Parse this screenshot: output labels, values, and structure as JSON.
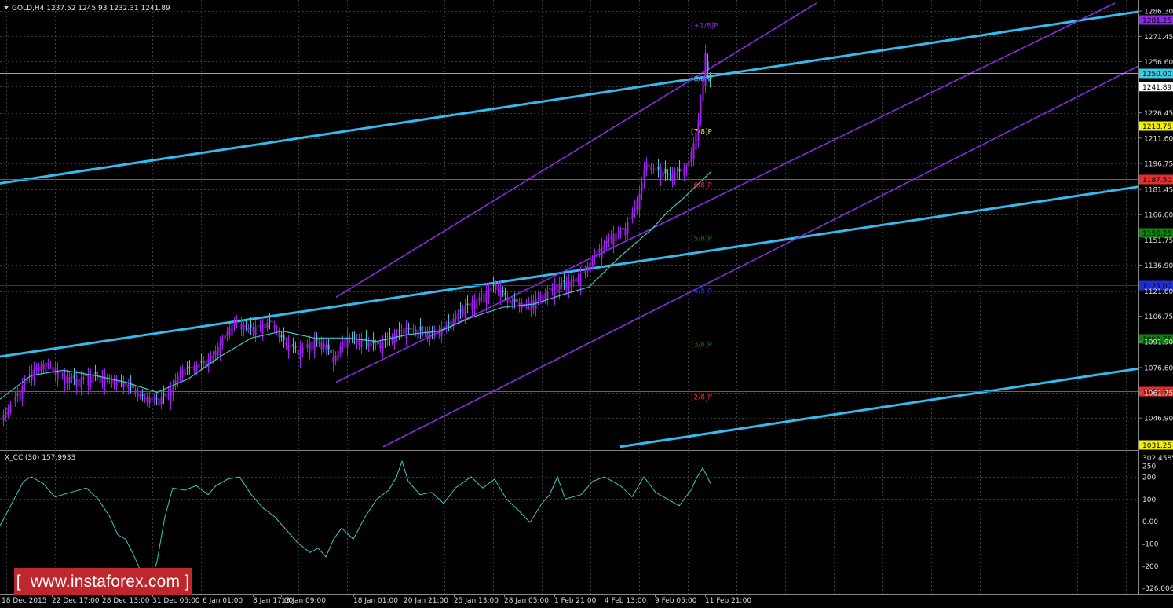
{
  "window": {
    "header": "GOLD,H4  1237.52 1245.93 1232.31 1241.89",
    "indicator_header": "X_CCI(30) 157.9933"
  },
  "colors": {
    "background": "#000000",
    "grid": "#3c3c3c",
    "candle": "#a020f0",
    "ma": "#40c8c8",
    "trend_cyan": "#33bbee",
    "channel": "#8a2be2",
    "cci": "#40c8c8",
    "watermark": "#c0272d"
  },
  "price_axis": {
    "ticks": [
      "1286.30",
      "1271.45",
      "1256.60",
      "1241.89",
      "1226.45",
      "1211.60",
      "1196.75",
      "1181.45",
      "1166.60",
      "1151.75",
      "1136.90",
      "1121.60",
      "1106.75",
      "1091.90",
      "1076.60",
      "1061.75",
      "1046.90"
    ],
    "range": [
      1028.5,
      1291
    ]
  },
  "levels": [
    {
      "value": "1281.25",
      "label": "[+1/8]P",
      "line_color": "#8a2be2",
      "box_color": "#8a2be2",
      "text_color": "#000000",
      "label_color": "#8a2be2"
    },
    {
      "value": "1250.00",
      "label": "[8/8]P",
      "line_color": "#40c8e0",
      "box_color": "#40c8e0",
      "text_color": "#000000",
      "label_color": "#40c8e0"
    },
    {
      "value": "1218.75",
      "label": "[7/8]P",
      "line_color": "#e8e8a0",
      "box_color": "#f0f000",
      "text_color": "#000000",
      "label_color": "#f0f000"
    },
    {
      "value": "1187.50",
      "label": "[6/8]P",
      "line_color": "#e03030",
      "box_color": "#e03030",
      "text_color": "#000000",
      "label_color": "#e03030"
    },
    {
      "value": "1156.25",
      "label": "[5/8]P",
      "line_color": "#108010",
      "box_color": "#108010",
      "text_color": "#000000",
      "label_color": "#108010"
    },
    {
      "value": "1125.00",
      "label": "[4/8]P",
      "line_color": "#2030d0",
      "box_color": "#2030d0",
      "text_color": "#000000",
      "label_color": "#2030d0"
    },
    {
      "value": "1093.75",
      "label": "[3/8]P",
      "line_color": "#108010",
      "box_color": "#108010",
      "text_color": "#000000",
      "label_color": "#108010"
    },
    {
      "value": "1062.50",
      "label": "[2/8]P",
      "line_color": "#e03030",
      "box_color": "#e03030",
      "text_color": "#000000",
      "label_color": "#e03030"
    },
    {
      "value": "1031.25",
      "label": "",
      "line_color": "#f0f000",
      "box_color": "#f0f000",
      "text_color": "#000000",
      "label_color": "#f0f000"
    }
  ],
  "current_price": "1241.89",
  "cci_axis": {
    "ticks": [
      "302.4585",
      "250",
      "200",
      "100",
      "0.00",
      "-100",
      "-200",
      "-326.0061"
    ]
  },
  "time_axis": {
    "labels": [
      "18 Dec 2015",
      "22 Dec 17:00",
      "28 Dec 13:00",
      "31 Dec 05:00",
      "6 Jan 01:00",
      "8 Jan 17:00",
      "13 Jan 09:00",
      "18 Jan 01:00",
      "20 Jan 21:00",
      "25 Jan 13:00",
      "28 Jan 05:00",
      "1 Feb 21:00",
      "4 Feb 13:00",
      "9 Feb 05:00",
      "11 Feb 21:00"
    ]
  },
  "price_path": [
    [
      0,
      1046
    ],
    [
      20,
      1060
    ],
    [
      40,
      1075
    ],
    [
      60,
      1080
    ],
    [
      80,
      1072
    ],
    [
      100,
      1070
    ],
    [
      120,
      1073
    ],
    [
      140,
      1070
    ],
    [
      160,
      1068
    ],
    [
      180,
      1060
    ],
    [
      200,
      1058
    ],
    [
      215,
      1062
    ],
    [
      230,
      1075
    ],
    [
      250,
      1078
    ],
    [
      270,
      1083
    ],
    [
      285,
      1095
    ],
    [
      300,
      1105
    ],
    [
      315,
      1100
    ],
    [
      330,
      1101
    ],
    [
      345,
      1104
    ],
    [
      360,
      1093
    ],
    [
      380,
      1087
    ],
    [
      400,
      1093
    ],
    [
      415,
      1090
    ],
    [
      425,
      1082
    ],
    [
      440,
      1095
    ],
    [
      460,
      1093
    ],
    [
      480,
      1090
    ],
    [
      500,
      1095
    ],
    [
      515,
      1100
    ],
    [
      530,
      1099
    ],
    [
      550,
      1097
    ],
    [
      570,
      1102
    ],
    [
      590,
      1112
    ],
    [
      610,
      1118
    ],
    [
      630,
      1126
    ],
    [
      650,
      1116
    ],
    [
      670,
      1114
    ],
    [
      690,
      1119
    ],
    [
      710,
      1126
    ],
    [
      730,
      1128
    ],
    [
      745,
      1134
    ],
    [
      760,
      1145
    ],
    [
      780,
      1155
    ],
    [
      795,
      1158
    ],
    [
      805,
      1168
    ],
    [
      815,
      1180
    ],
    [
      822,
      1198
    ],
    [
      830,
      1194
    ],
    [
      840,
      1193
    ],
    [
      850,
      1190
    ],
    [
      865,
      1192
    ],
    [
      875,
      1195
    ],
    [
      885,
      1212
    ],
    [
      890,
      1225
    ],
    [
      895,
      1248
    ],
    [
      898,
      1262
    ],
    [
      902,
      1247
    ],
    [
      906,
      1243
    ]
  ],
  "ma_path": [
    [
      0,
      1058
    ],
    [
      40,
      1072
    ],
    [
      80,
      1075
    ],
    [
      120,
      1072
    ],
    [
      160,
      1068
    ],
    [
      200,
      1062
    ],
    [
      240,
      1070
    ],
    [
      280,
      1083
    ],
    [
      320,
      1094
    ],
    [
      360,
      1098
    ],
    [
      400,
      1094
    ],
    [
      440,
      1094
    ],
    [
      480,
      1092
    ],
    [
      520,
      1096
    ],
    [
      560,
      1098
    ],
    [
      600,
      1106
    ],
    [
      640,
      1112
    ],
    [
      680,
      1114
    ],
    [
      720,
      1120
    ],
    [
      750,
      1124
    ],
    [
      770,
      1133
    ],
    [
      790,
      1142
    ],
    [
      810,
      1150
    ],
    [
      830,
      1158
    ],
    [
      850,
      1168
    ],
    [
      870,
      1176
    ],
    [
      890,
      1185
    ],
    [
      906,
      1192
    ]
  ],
  "cci_path": [
    [
      0,
      -20
    ],
    [
      15,
      80
    ],
    [
      30,
      180
    ],
    [
      40,
      200
    ],
    [
      55,
      170
    ],
    [
      70,
      110
    ],
    [
      90,
      130
    ],
    [
      110,
      150
    ],
    [
      125,
      100
    ],
    [
      140,
      20
    ],
    [
      150,
      -60
    ],
    [
      160,
      -80
    ],
    [
      170,
      -150
    ],
    [
      180,
      -230
    ],
    [
      190,
      -300
    ],
    [
      200,
      -180
    ],
    [
      210,
      20
    ],
    [
      220,
      150
    ],
    [
      235,
      140
    ],
    [
      250,
      160
    ],
    [
      265,
      120
    ],
    [
      275,
      160
    ],
    [
      290,
      190
    ],
    [
      305,
      200
    ],
    [
      320,
      120
    ],
    [
      335,
      60
    ],
    [
      350,
      20
    ],
    [
      365,
      -40
    ],
    [
      380,
      -100
    ],
    [
      395,
      -140
    ],
    [
      405,
      -120
    ],
    [
      415,
      -160
    ],
    [
      425,
      -80
    ],
    [
      435,
      -30
    ],
    [
      450,
      -80
    ],
    [
      465,
      20
    ],
    [
      480,
      100
    ],
    [
      495,
      140
    ],
    [
      505,
      200
    ],
    [
      512,
      270
    ],
    [
      520,
      180
    ],
    [
      535,
      120
    ],
    [
      550,
      130
    ],
    [
      565,
      80
    ],
    [
      580,
      150
    ],
    [
      600,
      200
    ],
    [
      615,
      150
    ],
    [
      630,
      190
    ],
    [
      645,
      100
    ],
    [
      660,
      50
    ],
    [
      675,
      -5
    ],
    [
      690,
      80
    ],
    [
      700,
      120
    ],
    [
      710,
      200
    ],
    [
      720,
      100
    ],
    [
      740,
      120
    ],
    [
      755,
      180
    ],
    [
      770,
      200
    ],
    [
      790,
      160
    ],
    [
      805,
      110
    ],
    [
      820,
      200
    ],
    [
      835,
      130
    ],
    [
      850,
      100
    ],
    [
      865,
      70
    ],
    [
      880,
      140
    ],
    [
      888,
      200
    ],
    [
      895,
      240
    ],
    [
      905,
      170
    ]
  ],
  "trendlines_cyan": [
    {
      "from": [
        0,
        1185
      ],
      "to": [
        1450,
        1286
      ]
    },
    {
      "from": [
        0,
        1083
      ],
      "to": [
        1450,
        1183
      ]
    },
    {
      "from": [
        790,
        1030
      ],
      "to": [
        1450,
        1076
      ]
    }
  ],
  "channel_lines": [
    {
      "from": [
        428,
        1118
      ],
      "to": [
        1040,
        1291
      ]
    },
    {
      "from": [
        428,
        1068
      ],
      "to": [
        1420,
        1291
      ]
    },
    {
      "from": [
        488,
        1030
      ],
      "to": [
        1450,
        1254
      ]
    }
  ]
}
